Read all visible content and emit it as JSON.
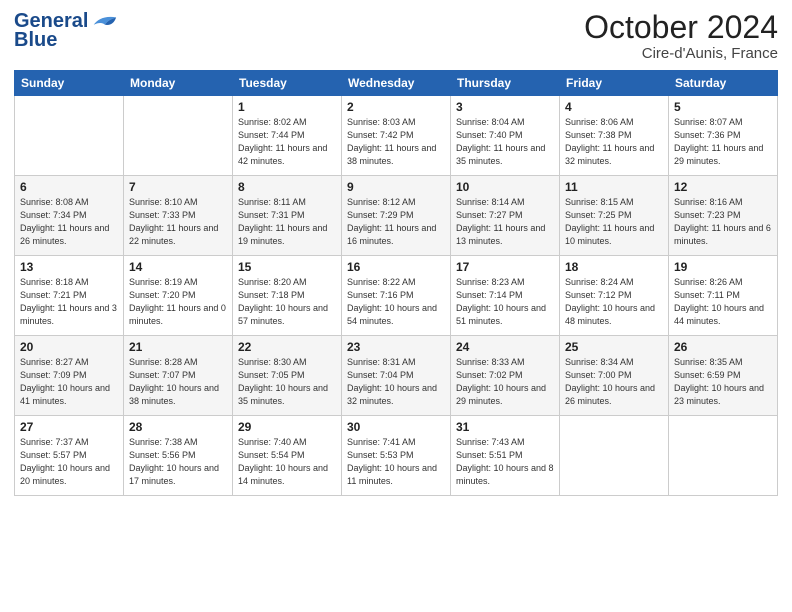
{
  "header": {
    "logo_line1": "General",
    "logo_line2": "Blue",
    "month": "October 2024",
    "location": "Cire-d'Aunis, France"
  },
  "weekdays": [
    "Sunday",
    "Monday",
    "Tuesday",
    "Wednesday",
    "Thursday",
    "Friday",
    "Saturday"
  ],
  "weeks": [
    [
      {
        "day": "",
        "sunrise": "",
        "sunset": "",
        "daylight": ""
      },
      {
        "day": "",
        "sunrise": "",
        "sunset": "",
        "daylight": ""
      },
      {
        "day": "1",
        "sunrise": "Sunrise: 8:02 AM",
        "sunset": "Sunset: 7:44 PM",
        "daylight": "Daylight: 11 hours and 42 minutes."
      },
      {
        "day": "2",
        "sunrise": "Sunrise: 8:03 AM",
        "sunset": "Sunset: 7:42 PM",
        "daylight": "Daylight: 11 hours and 38 minutes."
      },
      {
        "day": "3",
        "sunrise": "Sunrise: 8:04 AM",
        "sunset": "Sunset: 7:40 PM",
        "daylight": "Daylight: 11 hours and 35 minutes."
      },
      {
        "day": "4",
        "sunrise": "Sunrise: 8:06 AM",
        "sunset": "Sunset: 7:38 PM",
        "daylight": "Daylight: 11 hours and 32 minutes."
      },
      {
        "day": "5",
        "sunrise": "Sunrise: 8:07 AM",
        "sunset": "Sunset: 7:36 PM",
        "daylight": "Daylight: 11 hours and 29 minutes."
      }
    ],
    [
      {
        "day": "6",
        "sunrise": "Sunrise: 8:08 AM",
        "sunset": "Sunset: 7:34 PM",
        "daylight": "Daylight: 11 hours and 26 minutes."
      },
      {
        "day": "7",
        "sunrise": "Sunrise: 8:10 AM",
        "sunset": "Sunset: 7:33 PM",
        "daylight": "Daylight: 11 hours and 22 minutes."
      },
      {
        "day": "8",
        "sunrise": "Sunrise: 8:11 AM",
        "sunset": "Sunset: 7:31 PM",
        "daylight": "Daylight: 11 hours and 19 minutes."
      },
      {
        "day": "9",
        "sunrise": "Sunrise: 8:12 AM",
        "sunset": "Sunset: 7:29 PM",
        "daylight": "Daylight: 11 hours and 16 minutes."
      },
      {
        "day": "10",
        "sunrise": "Sunrise: 8:14 AM",
        "sunset": "Sunset: 7:27 PM",
        "daylight": "Daylight: 11 hours and 13 minutes."
      },
      {
        "day": "11",
        "sunrise": "Sunrise: 8:15 AM",
        "sunset": "Sunset: 7:25 PM",
        "daylight": "Daylight: 11 hours and 10 minutes."
      },
      {
        "day": "12",
        "sunrise": "Sunrise: 8:16 AM",
        "sunset": "Sunset: 7:23 PM",
        "daylight": "Daylight: 11 hours and 6 minutes."
      }
    ],
    [
      {
        "day": "13",
        "sunrise": "Sunrise: 8:18 AM",
        "sunset": "Sunset: 7:21 PM",
        "daylight": "Daylight: 11 hours and 3 minutes."
      },
      {
        "day": "14",
        "sunrise": "Sunrise: 8:19 AM",
        "sunset": "Sunset: 7:20 PM",
        "daylight": "Daylight: 11 hours and 0 minutes."
      },
      {
        "day": "15",
        "sunrise": "Sunrise: 8:20 AM",
        "sunset": "Sunset: 7:18 PM",
        "daylight": "Daylight: 10 hours and 57 minutes."
      },
      {
        "day": "16",
        "sunrise": "Sunrise: 8:22 AM",
        "sunset": "Sunset: 7:16 PM",
        "daylight": "Daylight: 10 hours and 54 minutes."
      },
      {
        "day": "17",
        "sunrise": "Sunrise: 8:23 AM",
        "sunset": "Sunset: 7:14 PM",
        "daylight": "Daylight: 10 hours and 51 minutes."
      },
      {
        "day": "18",
        "sunrise": "Sunrise: 8:24 AM",
        "sunset": "Sunset: 7:12 PM",
        "daylight": "Daylight: 10 hours and 48 minutes."
      },
      {
        "day": "19",
        "sunrise": "Sunrise: 8:26 AM",
        "sunset": "Sunset: 7:11 PM",
        "daylight": "Daylight: 10 hours and 44 minutes."
      }
    ],
    [
      {
        "day": "20",
        "sunrise": "Sunrise: 8:27 AM",
        "sunset": "Sunset: 7:09 PM",
        "daylight": "Daylight: 10 hours and 41 minutes."
      },
      {
        "day": "21",
        "sunrise": "Sunrise: 8:28 AM",
        "sunset": "Sunset: 7:07 PM",
        "daylight": "Daylight: 10 hours and 38 minutes."
      },
      {
        "day": "22",
        "sunrise": "Sunrise: 8:30 AM",
        "sunset": "Sunset: 7:05 PM",
        "daylight": "Daylight: 10 hours and 35 minutes."
      },
      {
        "day": "23",
        "sunrise": "Sunrise: 8:31 AM",
        "sunset": "Sunset: 7:04 PM",
        "daylight": "Daylight: 10 hours and 32 minutes."
      },
      {
        "day": "24",
        "sunrise": "Sunrise: 8:33 AM",
        "sunset": "Sunset: 7:02 PM",
        "daylight": "Daylight: 10 hours and 29 minutes."
      },
      {
        "day": "25",
        "sunrise": "Sunrise: 8:34 AM",
        "sunset": "Sunset: 7:00 PM",
        "daylight": "Daylight: 10 hours and 26 minutes."
      },
      {
        "day": "26",
        "sunrise": "Sunrise: 8:35 AM",
        "sunset": "Sunset: 6:59 PM",
        "daylight": "Daylight: 10 hours and 23 minutes."
      }
    ],
    [
      {
        "day": "27",
        "sunrise": "Sunrise: 7:37 AM",
        "sunset": "Sunset: 5:57 PM",
        "daylight": "Daylight: 10 hours and 20 minutes."
      },
      {
        "day": "28",
        "sunrise": "Sunrise: 7:38 AM",
        "sunset": "Sunset: 5:56 PM",
        "daylight": "Daylight: 10 hours and 17 minutes."
      },
      {
        "day": "29",
        "sunrise": "Sunrise: 7:40 AM",
        "sunset": "Sunset: 5:54 PM",
        "daylight": "Daylight: 10 hours and 14 minutes."
      },
      {
        "day": "30",
        "sunrise": "Sunrise: 7:41 AM",
        "sunset": "Sunset: 5:53 PM",
        "daylight": "Daylight: 10 hours and 11 minutes."
      },
      {
        "day": "31",
        "sunrise": "Sunrise: 7:43 AM",
        "sunset": "Sunset: 5:51 PM",
        "daylight": "Daylight: 10 hours and 8 minutes."
      },
      {
        "day": "",
        "sunrise": "",
        "sunset": "",
        "daylight": ""
      },
      {
        "day": "",
        "sunrise": "",
        "sunset": "",
        "daylight": ""
      }
    ]
  ]
}
